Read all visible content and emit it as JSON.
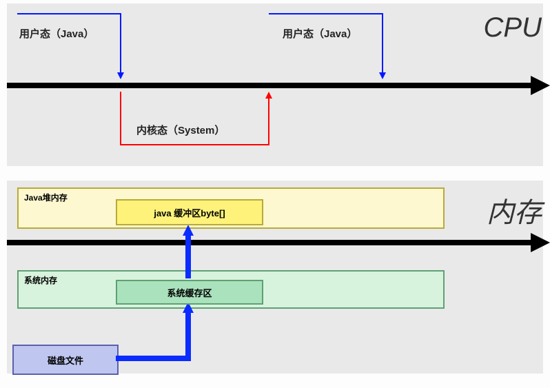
{
  "labels": {
    "cpu": "CPU",
    "memory": "内存"
  },
  "cpu": {
    "user_mode_1": "用户态（Java）",
    "user_mode_2": "用户态（Java）",
    "kernel_mode": "内核态（System）"
  },
  "memory": {
    "java_heap": "Java堆内存",
    "java_buffer": "java 缓冲区byte[]",
    "system_memory": "系统内存",
    "system_buffer": "系统缓存区",
    "disk_file": "磁盘文件"
  },
  "chart_data": {
    "type": "diagram",
    "title": "Java IO: CPU mode switching and memory data flow",
    "cpu_timeline": {
      "sequence": [
        "用户态（Java）",
        "内核态（System）",
        "用户态（Java）"
      ],
      "transitions": [
        {
          "from": "用户态（Java）",
          "to": "内核态（System）",
          "direction": "down",
          "color": "blue"
        },
        {
          "from": "内核态（System）",
          "to": "用户态（Java）",
          "direction": "up",
          "color": "red"
        },
        {
          "from": "用户态（Java）",
          "to": "end",
          "direction": "down",
          "color": "blue"
        }
      ]
    },
    "memory_flow": [
      {
        "from": "磁盘文件",
        "to": "系统缓存区",
        "color": "blue"
      },
      {
        "from": "系统缓存区",
        "to": "java 缓冲区byte[]",
        "color": "blue"
      }
    ],
    "memory_layers": [
      {
        "layer": "Java堆内存",
        "contains": "java 缓冲区byte[]"
      },
      {
        "layer": "系统内存",
        "contains": "系统缓存区"
      }
    ]
  }
}
